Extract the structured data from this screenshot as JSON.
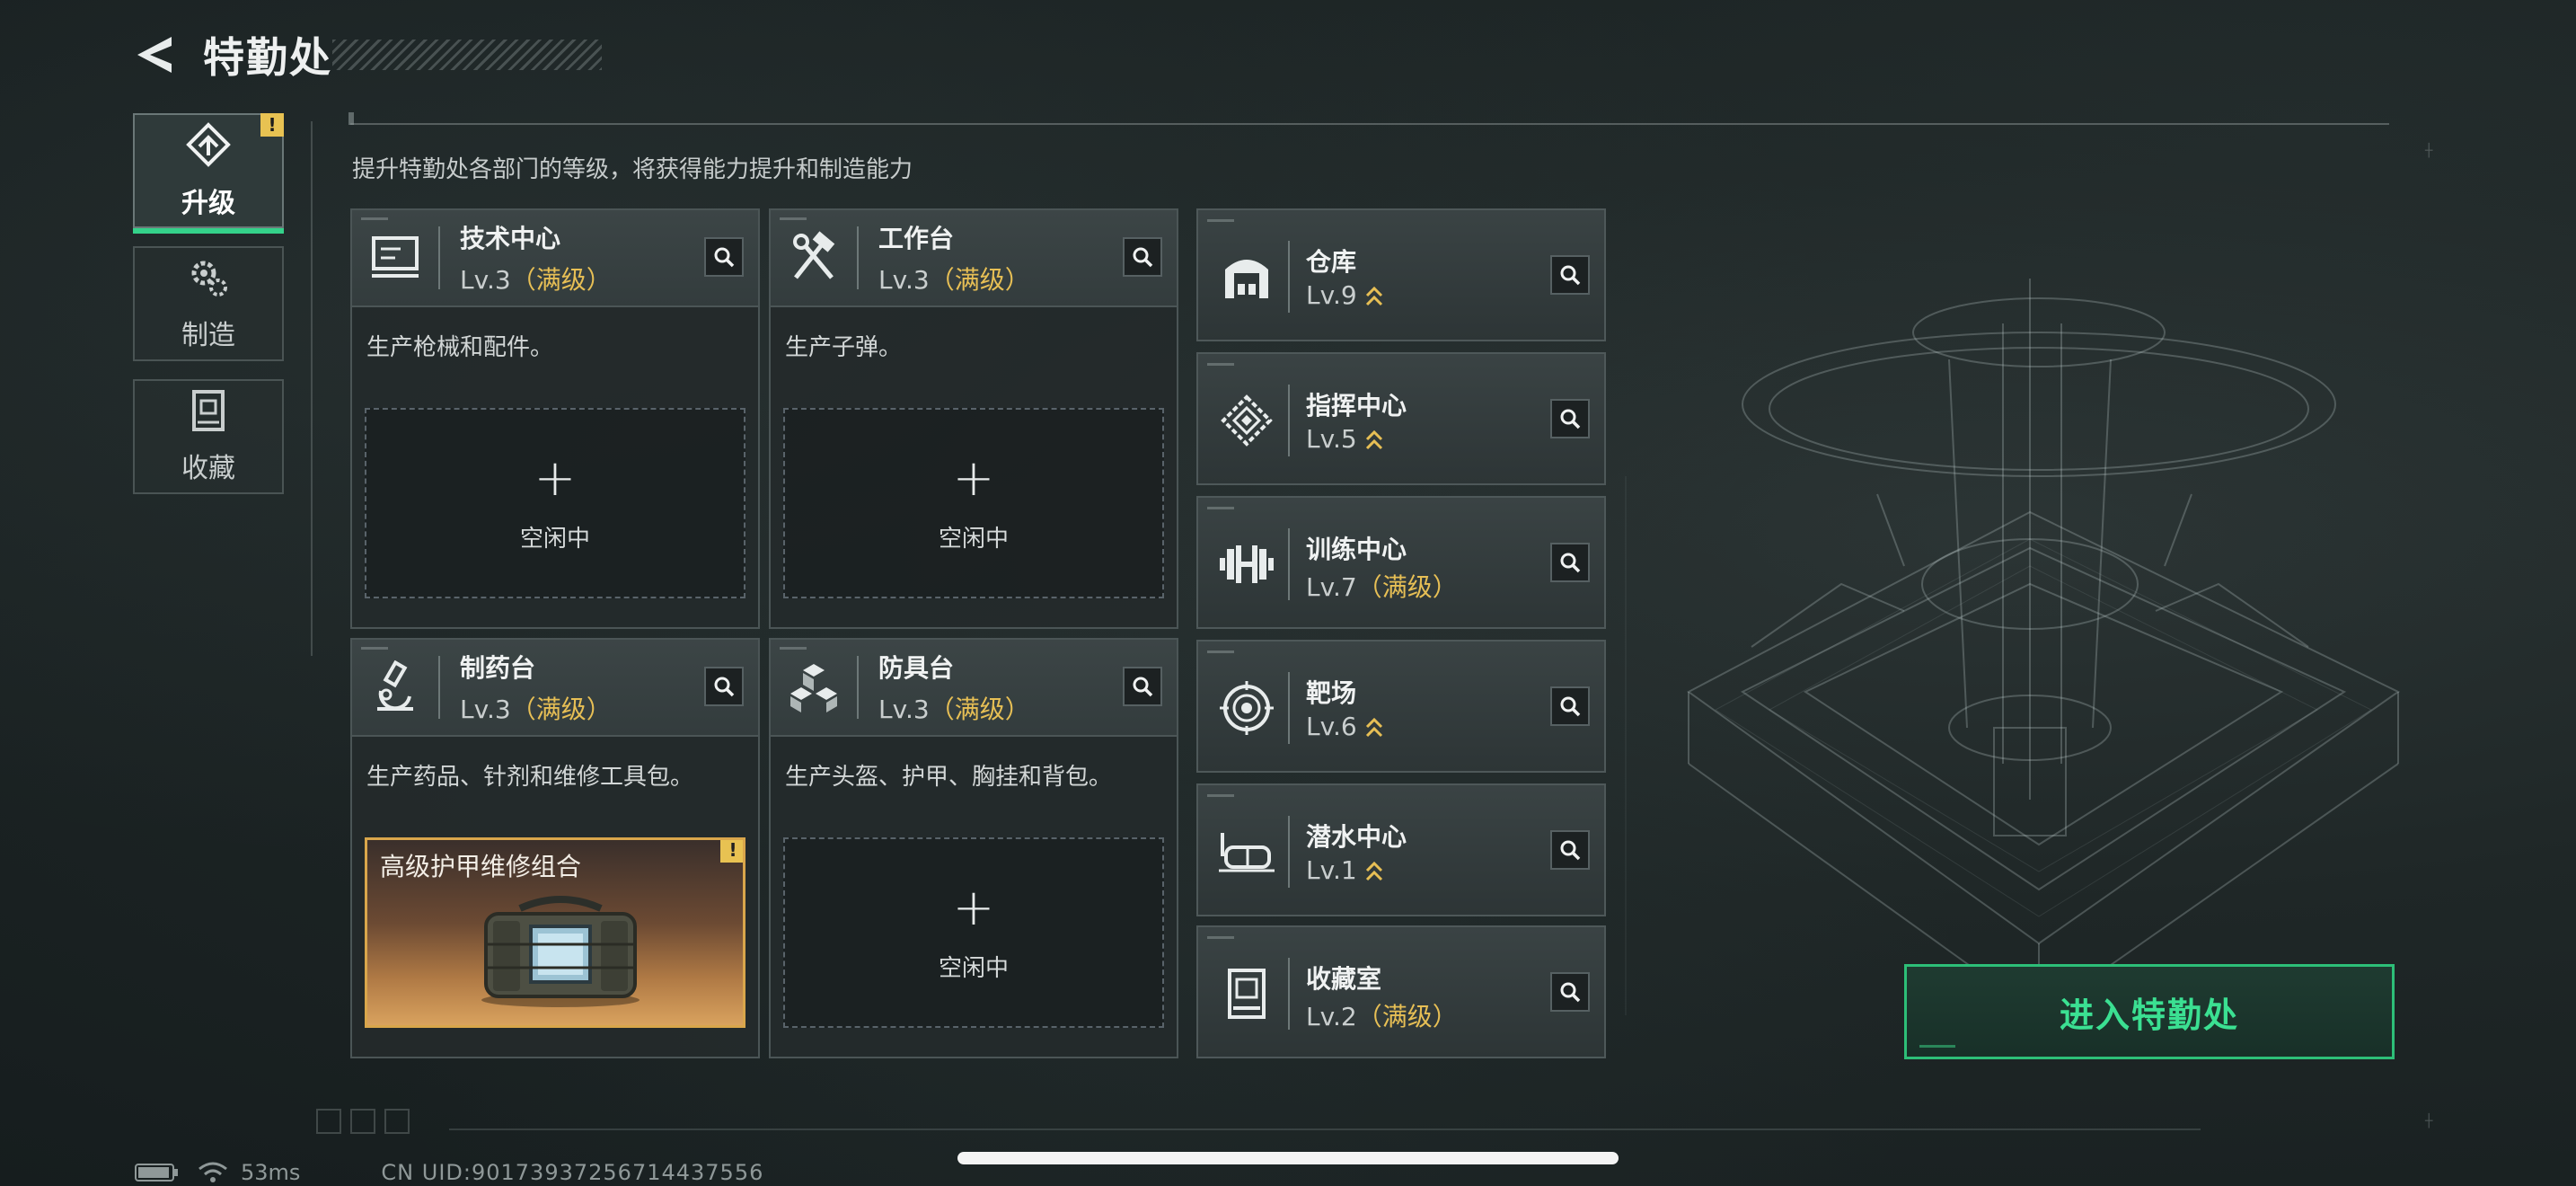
{
  "header": {
    "title": "特勤处"
  },
  "side_tabs": [
    {
      "label": "升级",
      "icon": "upgrade-icon",
      "active": true,
      "alert": "!"
    },
    {
      "label": "制造",
      "icon": "gears-icon",
      "active": false
    },
    {
      "label": "收藏",
      "icon": "collection-icon",
      "active": false
    }
  ],
  "subtitle": "提升特勤处各部门的等级，将获得能力提升和制造能力",
  "workstations": [
    {
      "name": "技术中心",
      "level": "Lv.3",
      "max": "（满级）",
      "icon": "tech-center-icon",
      "desc": "生产枪械和配件。",
      "slot": {
        "state": "idle",
        "plus": "+",
        "text": "空闲中"
      }
    },
    {
      "name": "工作台",
      "level": "Lv.3",
      "max": "（满级）",
      "icon": "workbench-icon",
      "desc": "生产子弹。",
      "slot": {
        "state": "idle",
        "plus": "+",
        "text": "空闲中"
      }
    },
    {
      "name": "制药台",
      "level": "Lv.3",
      "max": "（满级）",
      "icon": "pharmacy-icon",
      "desc": "生产药品、针剂和维修工具包。",
      "slot": {
        "state": "producing",
        "item_name": "高级护甲维修组合",
        "alert": "!"
      }
    },
    {
      "name": "防具台",
      "level": "Lv.3",
      "max": "（满级）",
      "icon": "armor-bench-icon",
      "desc": "生产头盔、护甲、胸挂和背包。",
      "slot": {
        "state": "idle",
        "plus": "+",
        "text": "空闲中"
      }
    }
  ],
  "facilities": [
    {
      "name": "仓库",
      "level": "Lv.9",
      "max": "",
      "upgradable": true,
      "icon": "warehouse-icon"
    },
    {
      "name": "指挥中心",
      "level": "Lv.5",
      "max": "",
      "upgradable": true,
      "icon": "command-center-icon"
    },
    {
      "name": "训练中心",
      "level": "Lv.7",
      "max": "（满级）",
      "upgradable": false,
      "icon": "dumbbell-icon"
    },
    {
      "name": "靶场",
      "level": "Lv.6",
      "max": "",
      "upgradable": true,
      "icon": "target-icon"
    },
    {
      "name": "潜水中心",
      "level": "Lv.1",
      "max": "",
      "upgradable": true,
      "icon": "diving-mask-icon"
    },
    {
      "name": "收藏室",
      "level": "Lv.2",
      "max": "（满级）",
      "upgradable": false,
      "icon": "collection-room-icon"
    }
  ],
  "enter_button": {
    "label": "进入特勤处"
  },
  "status": {
    "ping": "53ms",
    "uid": "CN UID:9017393725671443755​6"
  },
  "colors": {
    "accent_green": "#34d28a",
    "max_gold": "#e7bf55",
    "alert_yellow": "#e8c252"
  }
}
